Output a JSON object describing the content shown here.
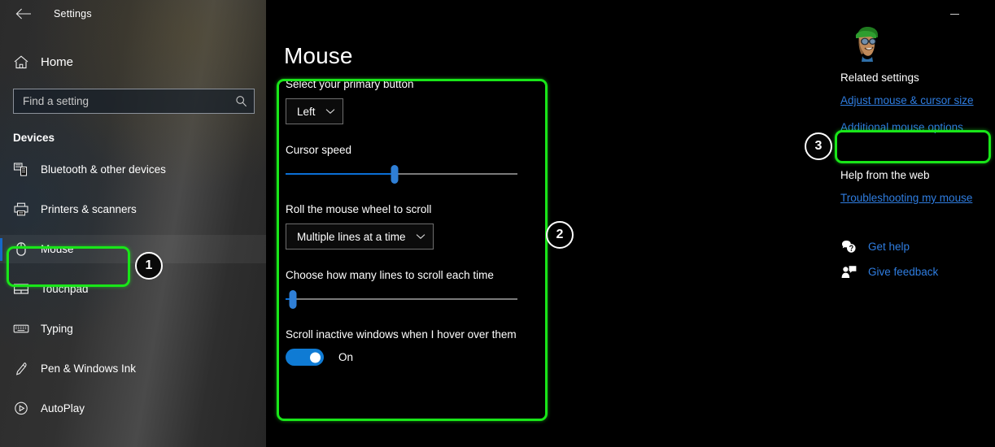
{
  "window": {
    "title": "Settings",
    "back_icon": "back-arrow-icon",
    "minimize_icon": "minimize-icon"
  },
  "sidebar": {
    "home_label": "Home",
    "home_icon": "home-icon",
    "search": {
      "placeholder": "Find a setting",
      "value": "",
      "icon": "search-icon"
    },
    "group_title": "Devices",
    "items": [
      {
        "label": "Bluetooth & other devices",
        "icon": "bluetooth-devices-icon",
        "selected": false
      },
      {
        "label": "Printers & scanners",
        "icon": "printer-icon",
        "selected": false
      },
      {
        "label": "Mouse",
        "icon": "mouse-icon",
        "selected": true
      },
      {
        "label": "Touchpad",
        "icon": "touchpad-icon",
        "selected": false
      },
      {
        "label": "Typing",
        "icon": "keyboard-icon",
        "selected": false
      },
      {
        "label": "Pen & Windows Ink",
        "icon": "pen-icon",
        "selected": false
      },
      {
        "label": "AutoPlay",
        "icon": "autoplay-icon",
        "selected": false
      }
    ]
  },
  "main": {
    "page_title": "Mouse",
    "primary_button": {
      "label": "Select your primary button",
      "value": "Left",
      "chevron_icon": "chevron-down-icon"
    },
    "cursor_speed": {
      "label": "Cursor speed",
      "percent": 47
    },
    "wheel_scroll": {
      "label": "Roll the mouse wheel to scroll",
      "value": "Multiple lines at a time",
      "chevron_icon": "chevron-down-icon"
    },
    "lines_to_scroll": {
      "label": "Choose how many lines to scroll each time",
      "percent": 3
    },
    "scroll_inactive": {
      "label": "Scroll inactive windows when I hover over them",
      "state": "On",
      "checked": true
    }
  },
  "right_column": {
    "avatar_icon": "user-avatar-icon",
    "related_settings_heading": "Related settings",
    "related_links": [
      "Adjust mouse & cursor size",
      "Additional mouse options"
    ],
    "help_heading": "Help from the web",
    "help_links": [
      "Troubleshooting my mouse"
    ],
    "support_links": [
      {
        "label": "Get help",
        "icon": "get-help-icon"
      },
      {
        "label": "Give feedback",
        "icon": "give-feedback-icon"
      }
    ]
  },
  "annotations": {
    "highlight_color": "#19e619",
    "badges": [
      {
        "number": "1",
        "target": "Mouse sidebar item"
      },
      {
        "number": "2",
        "target": "Mouse settings panel"
      },
      {
        "number": "3",
        "target": "Additional mouse options link"
      }
    ]
  },
  "colors": {
    "accent_blue": "#0f7bd4",
    "link_blue": "#2f7de0",
    "highlight_green": "#19e619",
    "background": "#000000"
  }
}
